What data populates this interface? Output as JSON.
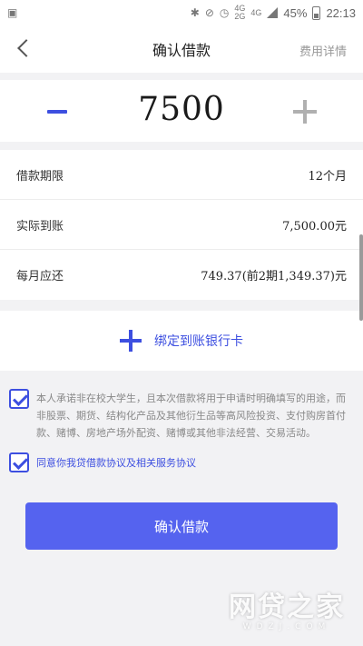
{
  "status_bar": {
    "time": "22:13",
    "battery_percent": "45%",
    "network_top": "4G",
    "network_bottom": "2G",
    "network_alt": "4G",
    "icons": [
      "image-icon",
      "bluetooth-icon",
      "mute-icon",
      "alarm-icon",
      "signal-icon",
      "battery-icon"
    ]
  },
  "nav": {
    "title": "确认借款",
    "right_link": "费用详情"
  },
  "amount": {
    "value": "7500"
  },
  "info_rows": [
    {
      "label": "借款期限",
      "value": "12个月"
    },
    {
      "label": "实际到账",
      "value": "7,500.00元"
    },
    {
      "label": "每月应还",
      "value": "749.37(前2期1,349.37)元"
    }
  ],
  "bind_card": {
    "label": "绑定到账银行卡"
  },
  "agreements": {
    "pledge_text": "本人承诺非在校大学生，且本次借款将用于申请时明确填写的用途，而非股票、期货、结构化产品及其他衍生品等高风险投资、支付购房首付款、赌博、房地产场外配资、赌博或其他非法经营、交易活动。",
    "protocol_text": "同意你我贷借款协议及相关服务协议"
  },
  "confirm_button": {
    "label": "确认借款"
  },
  "watermark": {
    "main": "网贷之家",
    "sub": "WDZJ.COM"
  },
  "colors": {
    "accent": "#3d4fe0",
    "button": "#5563ef",
    "background": "#f2f2f4"
  }
}
